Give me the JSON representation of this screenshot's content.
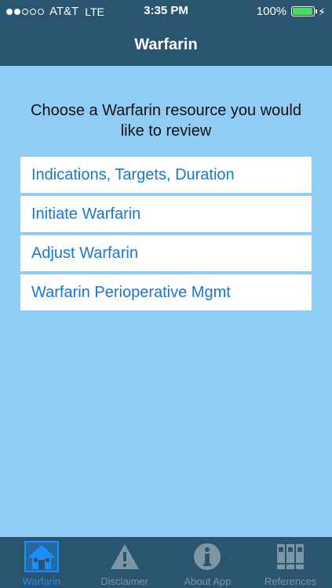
{
  "status_bar": {
    "carrier": "AT&T",
    "network": "LTE",
    "time": "3:35 PM",
    "battery": "100%",
    "battery_level": 1.0,
    "signal_bars_filled": 2,
    "signal_bars_total": 5
  },
  "nav": {
    "title": "Warfarin"
  },
  "prompt": "Choose a Warfarin resource you would like to review",
  "menu": {
    "items": [
      {
        "label": "Indications, Targets, Duration"
      },
      {
        "label": "Initiate Warfarin"
      },
      {
        "label": "Adjust Warfarin"
      },
      {
        "label": "Warfarin Perioperative Mgmt"
      }
    ]
  },
  "tabs": [
    {
      "label": "Warfarin",
      "icon": "house-icon",
      "active": true
    },
    {
      "label": "Disclaimer",
      "icon": "warning-icon",
      "active": false
    },
    {
      "label": "About App",
      "icon": "info-icon",
      "active": false
    },
    {
      "label": "References",
      "icon": "binders-icon",
      "active": false
    }
  ],
  "colors": {
    "header_bg": "#2a5570",
    "content_bg": "#8fcdf7",
    "link": "#1a77c9",
    "tab_active": "#1e8eff",
    "tab_inactive": "#7d96a6"
  }
}
